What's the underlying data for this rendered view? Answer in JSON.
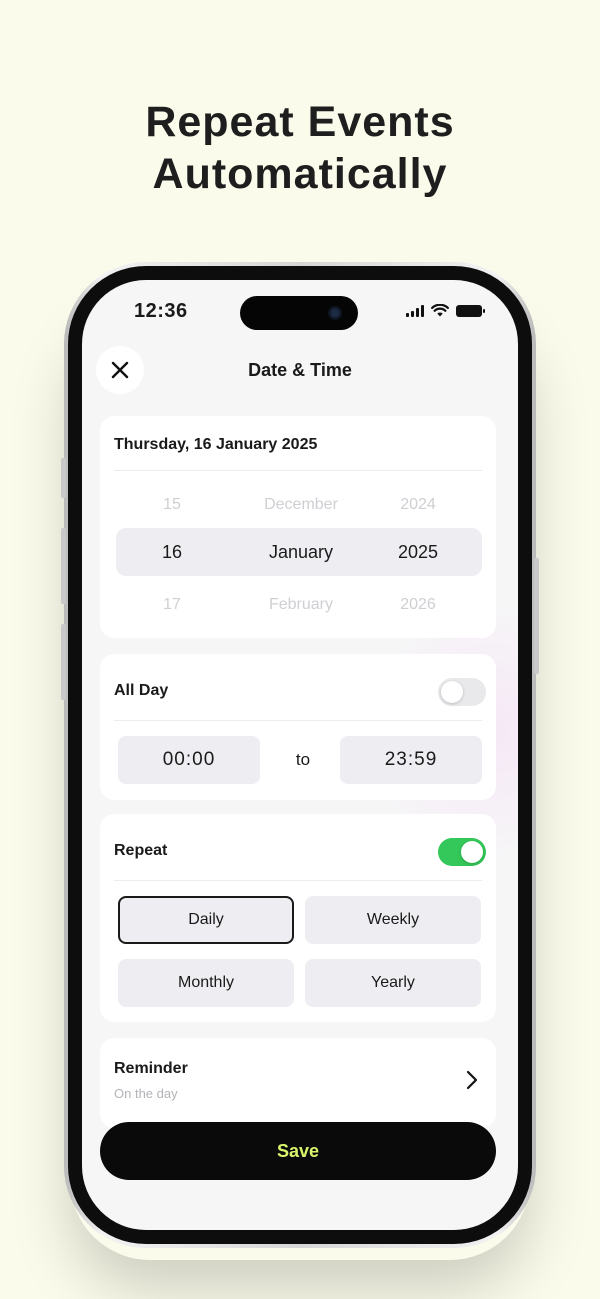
{
  "headline": {
    "line1": "Repeat Events",
    "line2": "Automatically"
  },
  "status_bar": {
    "time": "12:36"
  },
  "header": {
    "title": "Date  & Time"
  },
  "date_card": {
    "selected_date_text": "Thursday, 16 January 2025",
    "picker": {
      "prev": {
        "day": "15",
        "month": "December",
        "year": "2024"
      },
      "current": {
        "day": "16",
        "month": "January",
        "year": "2025"
      },
      "next": {
        "day": "17",
        "month": "February",
        "year": "2026"
      }
    }
  },
  "all_day": {
    "label": "All Day",
    "enabled": false,
    "start": "00:00",
    "separator": "to",
    "end": "23:59"
  },
  "repeat": {
    "label": "Repeat",
    "enabled": true,
    "options": [
      "Daily",
      "Weekly",
      "Monthly",
      "Yearly"
    ],
    "selected": "Daily"
  },
  "reminder": {
    "title": "Reminder",
    "value": "On the day"
  },
  "save": {
    "label": "Save"
  },
  "colors": {
    "background": "#fbfbeb",
    "toggle_on": "#34c759",
    "save_bg": "#0a0a0a",
    "save_text": "#d9f56b"
  }
}
